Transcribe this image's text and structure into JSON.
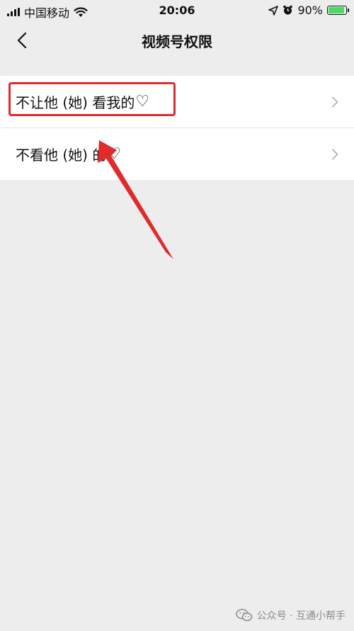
{
  "status_bar": {
    "carrier": "中国移动",
    "time": "20:06",
    "battery": "90%",
    "battery_level": 0.9
  },
  "nav": {
    "title": "视频号权限"
  },
  "list": {
    "items": [
      {
        "label": "不让他 (她) 看我的",
        "heart": "♡"
      },
      {
        "label": "不看他 (她) 的",
        "heart": "♡"
      }
    ]
  },
  "watermark": {
    "text": "公众号 · 互通小帮手"
  },
  "colors": {
    "annotation": "#e02b2b",
    "background": "#ededed"
  }
}
